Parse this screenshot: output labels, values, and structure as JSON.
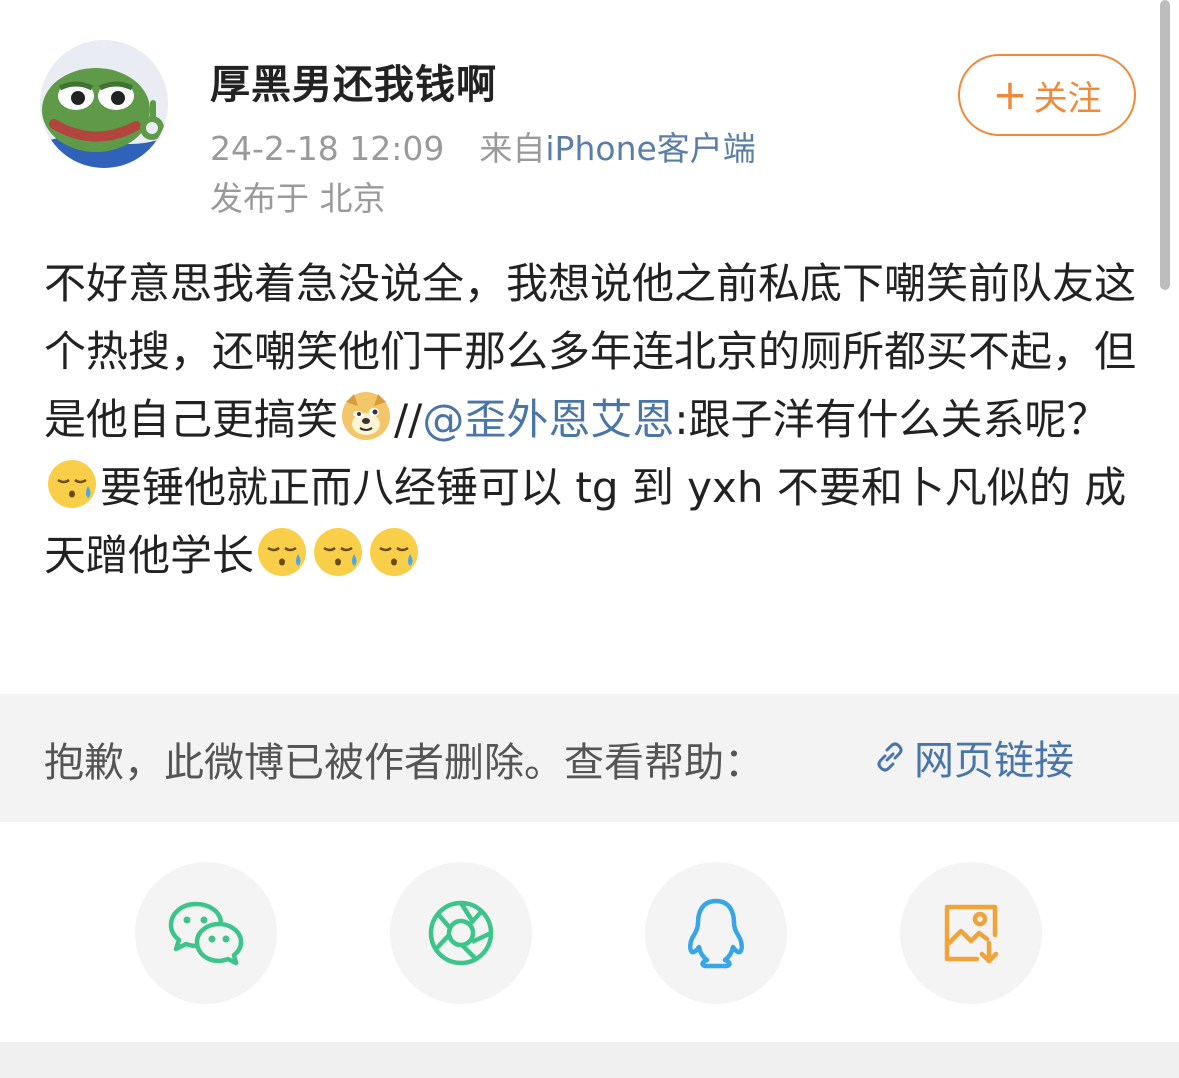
{
  "user": {
    "name": "厚黑男还我钱啊",
    "timestamp": "24-2-18 12:09",
    "source_prefix": "来自",
    "source": "iPhone客户端",
    "location": "发布于 北京"
  },
  "follow": {
    "plus": "+",
    "label": "关注"
  },
  "post": {
    "part1": "不好意思我着急没说全，我想说他之前私底下嘲笑前队友这个热搜，还嘲笑他们干那么多年连北京的厕所都买不起，但是他自己更搞笑",
    "repost_sep": "//",
    "mention": "@歪外恩艾恩",
    "part2": ":跟子洋有什么关系呢？",
    "part3": "要锤他就正而八经锤可以 tg 到 yxh 不要和卜凡似的 成天蹭他学长",
    "emoji_doge": "doge-emoji",
    "emoji_sweat": "sweat-face-emoji"
  },
  "deleted": {
    "message": "抱歉，此微博已被作者删除。查看帮助：",
    "link_label": "网页链接",
    "link_icon": "link-icon"
  },
  "share": {
    "wechat": {
      "icon": "wechat-icon",
      "color": "#3cc48a"
    },
    "moments": {
      "icon": "wechat-moments-icon",
      "color": "#3cc48a"
    },
    "qq": {
      "icon": "qq-icon",
      "color": "#3aa5e6"
    },
    "save_image": {
      "icon": "save-image-icon",
      "color": "#f0a23b"
    }
  }
}
